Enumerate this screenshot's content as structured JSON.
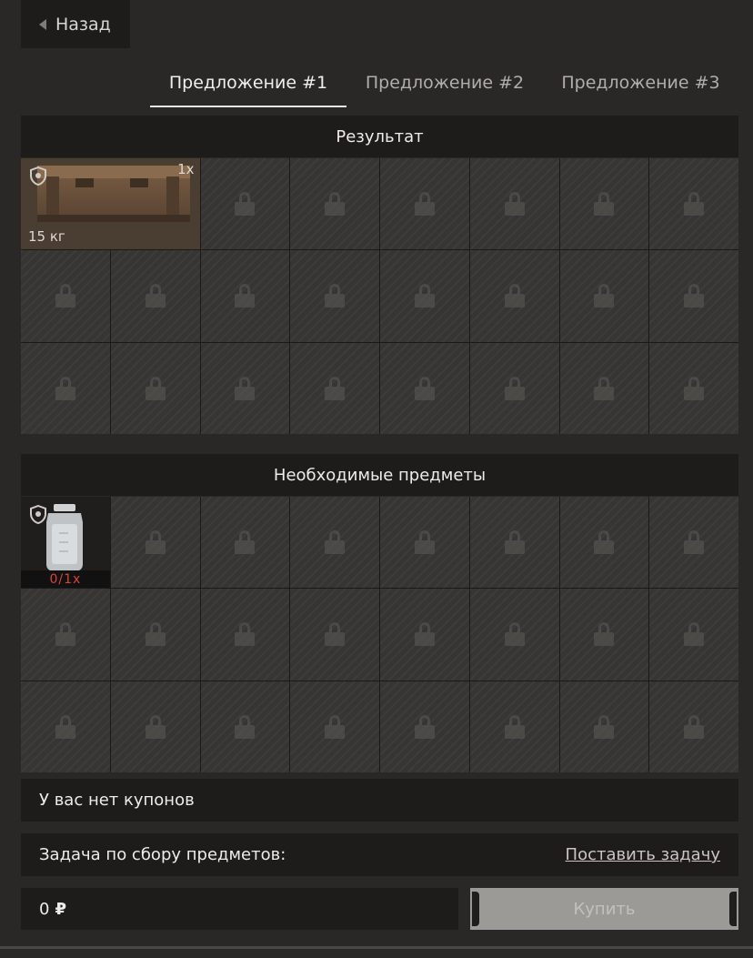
{
  "back_button": {
    "label": "Назад"
  },
  "tabs": [
    {
      "label": "Предложение #1",
      "active": true
    },
    {
      "label": "Предложение #2",
      "active": false
    },
    {
      "label": "Предложение #3",
      "active": false
    }
  ],
  "result": {
    "title": "Результат",
    "item": {
      "icon": "ammo-crate-icon",
      "quantity": "1x",
      "weight": "15 кг"
    },
    "locked_icon": "lock-icon"
  },
  "required": {
    "title": "Необходимые предметы",
    "item": {
      "icon": "jar-icon",
      "count": "0/1x"
    }
  },
  "coupons": {
    "text": "У вас нет купонов"
  },
  "task": {
    "label": "Задача по сбору предметов:",
    "action": "Поставить задачу"
  },
  "price": {
    "amount": "0",
    "currency": "₽"
  },
  "buy_button": {
    "label": "Купить",
    "enabled": false
  },
  "colors": {
    "background": "#2a2826",
    "panel": "#1d1c1b",
    "required_count": "#d8433a",
    "buy_disabled": "#9c9a97"
  }
}
